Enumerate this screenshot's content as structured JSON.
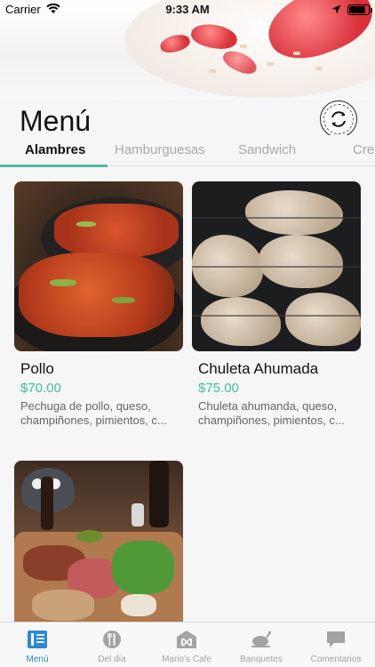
{
  "status": {
    "carrier": "Carrier",
    "time": "9:33 AM",
    "battery_level": 0.85
  },
  "header": {
    "title": "Menú"
  },
  "tabs": [
    {
      "label": "Alambres",
      "active": true
    },
    {
      "label": "Hamburguesas",
      "active": false
    },
    {
      "label": "Sandwich",
      "active": false
    },
    {
      "label": "Cre",
      "active": false
    }
  ],
  "items": [
    {
      "name": "Pollo",
      "price": "$70.00",
      "description": "Pechuga de pollo, queso, champiñones, pimientos, c..."
    },
    {
      "name": "Chuleta Ahumada",
      "price": "$75.00",
      "description": "Chuleta ahumanda, queso, champiñones, pimientos, c..."
    },
    {
      "name": "",
      "price": "",
      "description": ""
    }
  ],
  "tabbar": [
    {
      "label": "Menú",
      "icon": "menu-book-icon",
      "active": true
    },
    {
      "label": "Del día",
      "icon": "plate-fork-knife-icon",
      "active": false
    },
    {
      "label": "Mario's Cafe",
      "icon": "restaurant-building-icon",
      "active": false
    },
    {
      "label": "Banquetes",
      "icon": "roast-chicken-icon",
      "active": false
    },
    {
      "label": "Comentarios",
      "icon": "comment-bubble-icon",
      "active": false
    }
  ],
  "colors": {
    "accent": "#52b8a5",
    "price": "#3fbfa0",
    "tab_active": "#2a88d8",
    "tab_inactive": "#a3a3a3"
  }
}
